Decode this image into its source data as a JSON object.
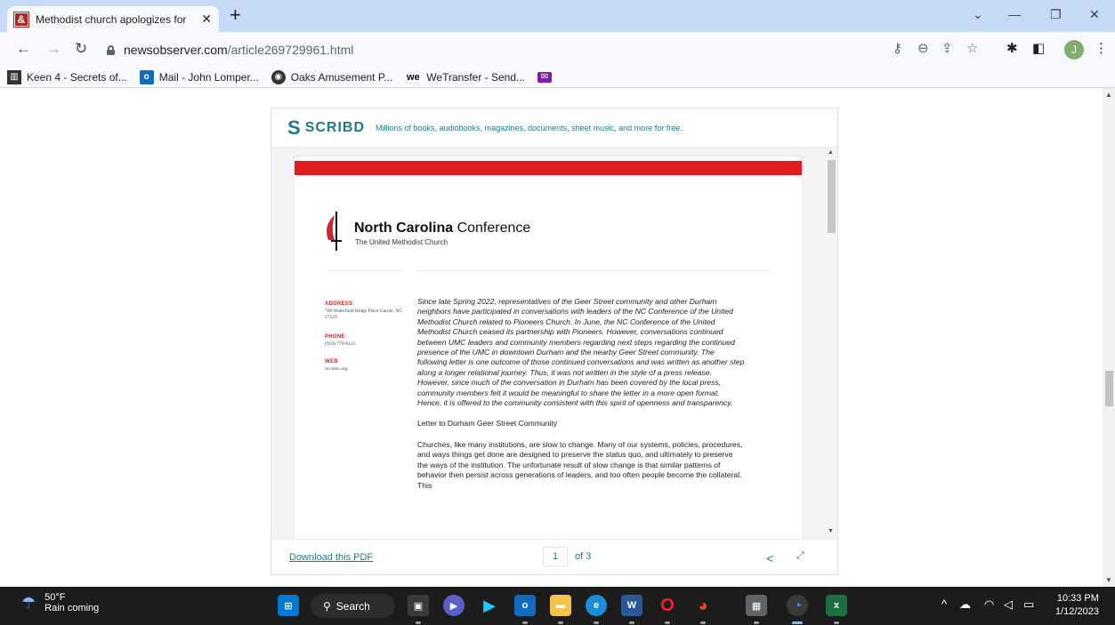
{
  "browser": {
    "tab": {
      "title": "Methodist church apologizes for",
      "favicon": "&"
    },
    "url": {
      "host": "newsobserver.com",
      "path": "/article269729961.html"
    },
    "bookmarks": [
      {
        "label": "Keen 4 - Secrets of..."
      },
      {
        "label": "Mail - John Lomper..."
      },
      {
        "label": "Oaks Amusement P..."
      },
      {
        "label": "WeTransfer - Send..."
      }
    ],
    "profile_initial": "J"
  },
  "scribd": {
    "logo": "SCRIBD",
    "tagline": "Millions of books, audiobooks, magazines, documents, sheet music, and more for free.",
    "download_label": "Download this PDF",
    "page_current": "1",
    "page_total_label": "of 3"
  },
  "document": {
    "org_bold": "North Carolina",
    "org_rest": " Conference",
    "org_sub": "The United Methodist Church",
    "address_label": "ADDRESS",
    "address_value": "700 Waterfield Ridge Place Garner, NC 27529",
    "phone_label": "PHONE",
    "phone_value": "(919) 779-6115",
    "web_label": "WEB",
    "web_value": "nccumc.org",
    "intro": "Since late Spring 2022, representatives of the Geer Street community and other Durham neighbors have participated in conversations with leaders of the NC Conference of the United Methodist Church related to Pioneers Church. In June, the NC Conference of the United Methodist Church ceased its partnership with Pioneers. However, conversations continued between UMC leaders and community members regarding next steps regarding the continued presence of the UMC in downtown Durham and the nearby Geer Street community. The following letter is one outcome of those continued conversations and was written as another step along a longer relational journey. Thus, it was not written in the style of a press release. However, since much of the conversation in Durham has been covered by the local press, community members felt it would be meaningful to share the letter in a more open format. Hence, it is offered to the community consistent with this spirit of openness and transparency.",
    "letter_heading": "Letter to Durham Geer Street Community",
    "para1": "Churches, like many institutions, are slow to change. Many of our systems, policies, procedures, and ways things get done are designed to preserve the status quo, and ultimately to preserve the ways of the institution. The unfortunate result of slow change is that similar patterns of behavior then persist across generations of leaders, and too often people become the collateral. This"
  },
  "taskbar": {
    "temp": "50°F",
    "forecast": "Rain coming",
    "search_label": "Search",
    "time": "10:33 PM",
    "date": "1/12/2023"
  },
  "colors": {
    "scribd_teal": "#1e7b85",
    "umc_red": "#e31b23",
    "chrome_tabstrip": "#c6d9f7"
  }
}
